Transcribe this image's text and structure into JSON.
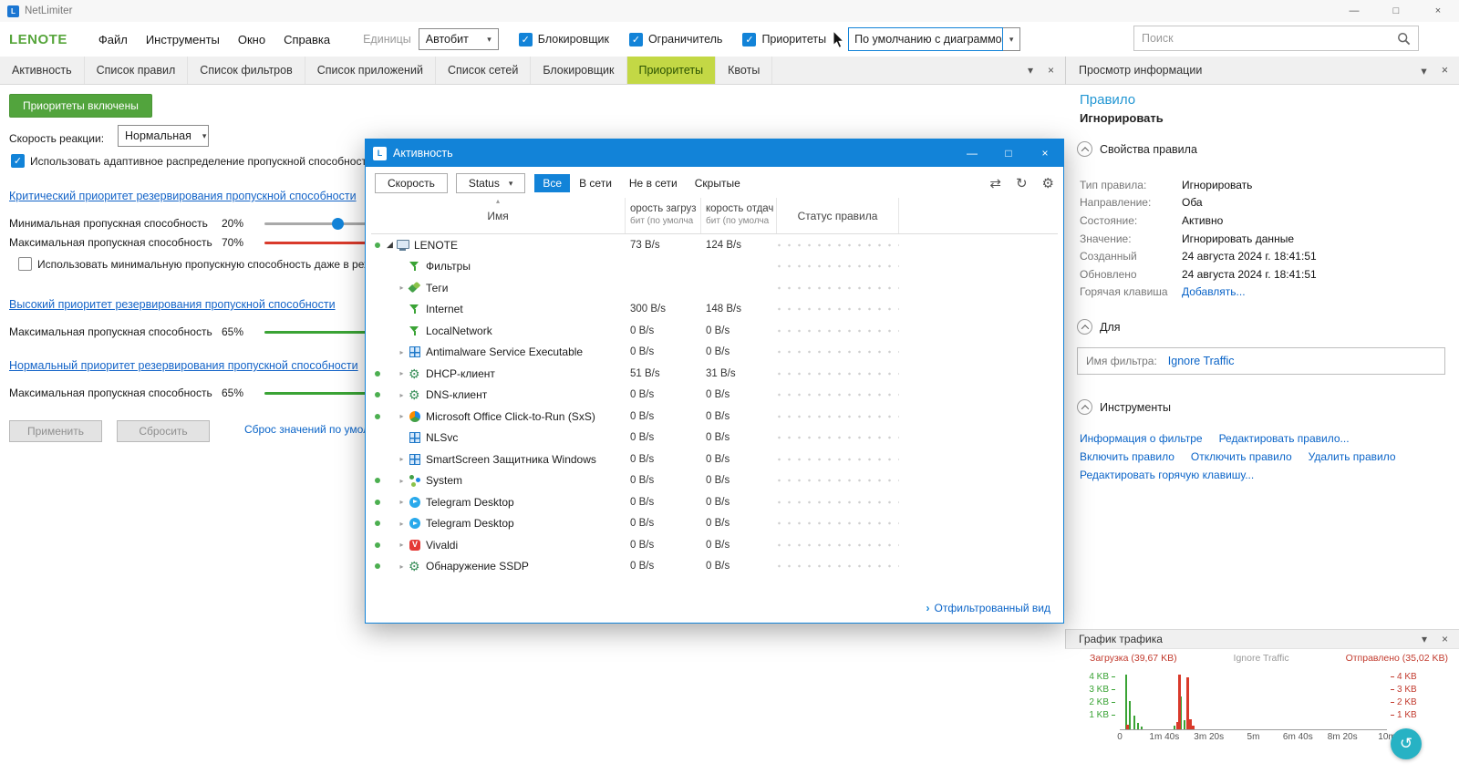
{
  "icons": {
    "check": "✓",
    "dropdown": "▾",
    "close": "×",
    "minimize": "—",
    "maximize": "□",
    "refresh": "↻",
    "gear": "⚙",
    "dock": "⇄",
    "collapsed": "▸",
    "expanded": "◢",
    "chevron_right": "›",
    "sort_asc": "▴",
    "undo": "↺"
  },
  "titlebar": {
    "app_title": "NetLimiter"
  },
  "menubar": {
    "logo": "LENOTE",
    "items": [
      "Файл",
      "Инструменты",
      "Окно",
      "Справка"
    ],
    "units_label": "Единицы",
    "units_value": "Автобит",
    "checkboxes": [
      "Блокировщик",
      "Ограничитель",
      "Приоритеты"
    ],
    "chart_mode_value": "По умолчанию с диаграммой",
    "search_placeholder": "Поиск"
  },
  "tabs": [
    {
      "label": "Активность"
    },
    {
      "label": "Список правил"
    },
    {
      "label": "Список фильтров"
    },
    {
      "label": "Список приложений"
    },
    {
      "label": "Список сетей"
    },
    {
      "label": "Блокировщик"
    },
    {
      "label": "Приоритеты",
      "active": true
    },
    {
      "label": "Квоты"
    }
  ],
  "priorities": {
    "enabled_button": "Приоритеты включены",
    "reaction_label": "Скорость реакции:",
    "reaction_value": "Нормальная",
    "adaptive_label": "Использовать адаптивное распределение пропускной способности",
    "critical_heading": "Критический приоритет резервирования пропускной способности",
    "min_label": "Минимальная пропускная способность",
    "min_value": "20%",
    "max_label": "Максимальная пропускная способность",
    "max_value": "70%",
    "idle_label": "Использовать минимальную пропускную способность даже в реж",
    "high_heading": "Высокий приоритет резервирования пропускной способности",
    "high_max_label": "Максимальная пропускная способность",
    "high_max_value": "65%",
    "normal_heading": "Нормальный приоритет резервирования пропускной способности",
    "normal_max_label": "Максимальная пропускная способность",
    "normal_max_value": "65%",
    "apply_button": "Применить",
    "reset_button": "Сбросить",
    "defaults_link": "Сброс значений по умолч"
  },
  "activity": {
    "title": "Активность",
    "toolbar": {
      "speed_button": "Скорость",
      "status_dropdown": "Status",
      "filters": [
        {
          "label": "Все",
          "active": true
        },
        {
          "label": "В сети"
        },
        {
          "label": "Не в сети"
        },
        {
          "label": "Скрытые"
        }
      ]
    },
    "columns": {
      "name": "Имя",
      "download_line1": "орость загруз",
      "download_line2": "бит (по умолча",
      "upload_line1": "корость отдач",
      "upload_line2": "бит (по умолча",
      "status": "Статус правила"
    },
    "rows": [
      {
        "name": "LENOTE",
        "icon": "monitor",
        "indent": 0,
        "tri": "exp",
        "online": true,
        "down": "73 B/s",
        "up": "124 B/s"
      },
      {
        "name": "Фильтры",
        "icon": "funnel",
        "indent": 1,
        "tri": "",
        "online": false,
        "down": "",
        "up": ""
      },
      {
        "name": "Теги",
        "icon": "tags",
        "indent": 1,
        "tri": "col",
        "online": false,
        "down": "",
        "up": ""
      },
      {
        "name": "Internet",
        "icon": "funnel",
        "indent": 1,
        "tri": "",
        "online": false,
        "down": "300 B/s",
        "up": "148 B/s"
      },
      {
        "name": "LocalNetwork",
        "icon": "funnel",
        "indent": 1,
        "tri": "",
        "online": false,
        "down": "0 B/s",
        "up": "0 B/s"
      },
      {
        "name": "Antimalware Service Executable",
        "icon": "window",
        "indent": 1,
        "tri": "col",
        "online": false,
        "down": "0 B/s",
        "up": "0 B/s"
      },
      {
        "name": "DHCP-клиент",
        "icon": "gear",
        "indent": 1,
        "tri": "col",
        "online": true,
        "down": "51 B/s",
        "up": "31 B/s"
      },
      {
        "name": "DNS-клиент",
        "icon": "gear",
        "indent": 1,
        "tri": "col",
        "online": true,
        "down": "0 B/s",
        "up": "0 B/s"
      },
      {
        "name": "Microsoft Office Click-to-Run (SxS)",
        "icon": "office",
        "indent": 1,
        "tri": "col",
        "online": true,
        "down": "0 B/s",
        "up": "0 B/s"
      },
      {
        "name": "NLSvc",
        "icon": "window",
        "indent": 1,
        "tri": "",
        "online": false,
        "down": "0 B/s",
        "up": "0 B/s"
      },
      {
        "name": "SmartScreen Защитника Windows",
        "icon": "window",
        "indent": 1,
        "tri": "col",
        "online": false,
        "down": "0 B/s",
        "up": "0 B/s"
      },
      {
        "name": "System",
        "icon": "system",
        "indent": 1,
        "tri": "col",
        "online": true,
        "down": "0 B/s",
        "up": "0 B/s"
      },
      {
        "name": "Telegram Desktop",
        "icon": "telegram",
        "indent": 1,
        "tri": "col",
        "online": true,
        "down": "0 B/s",
        "up": "0 B/s"
      },
      {
        "name": "Telegram Desktop",
        "icon": "telegram",
        "indent": 1,
        "tri": "col",
        "online": true,
        "down": "0 B/s",
        "up": "0 B/s"
      },
      {
        "name": "Vivaldi",
        "icon": "vivaldi",
        "indent": 1,
        "tri": "col",
        "online": true,
        "down": "0 B/s",
        "up": "0 B/s"
      },
      {
        "name": "Обнаружение SSDP",
        "icon": "gear",
        "indent": 1,
        "tri": "col",
        "online": true,
        "down": "0 B/s",
        "up": "0 B/s"
      }
    ],
    "footer_link": "Отфильтрованный вид"
  },
  "info": {
    "header": "Просмотр информации",
    "object_type": "Правило",
    "object_name": "Игнорировать",
    "properties_title": "Свойства правила",
    "properties": [
      {
        "label": "Тип правила:",
        "value": "Игнорировать"
      },
      {
        "label": "Направление:",
        "value": "Оба"
      },
      {
        "label": "Состояние:",
        "value": "Активно"
      },
      {
        "label": "Значение:",
        "value": "Игнорировать данные"
      },
      {
        "label": "Созданный",
        "value": "24 августа 2024 г. 18:41:51"
      },
      {
        "label": "Обновлено",
        "value": "24 августа 2024 г. 18:41:51"
      },
      {
        "label": "Горячая клавиша",
        "value": "Добавлять...",
        "link": true
      }
    ],
    "for_title": "Для",
    "filter_label": "Имя фильтра:",
    "filter_value": "Ignore Traffic",
    "tools_title": "Инструменты",
    "tools": {
      "lines": [
        [
          "Информация о фильтре",
          "Редактировать правило..."
        ],
        [
          "Включить правило",
          "Отключить правило",
          "Удалить правило"
        ],
        [
          "Редактировать горячую клавишу..."
        ]
      ]
    }
  },
  "traffic": {
    "header": "График трафика"
  },
  "chart_data": {
    "type": "area",
    "title": "График трафика",
    "legend": [
      "Загрузка (39,67 KB)",
      "Ignore Traffic",
      "Отправлено (35,02 KB)"
    ],
    "legend_position": "top",
    "x_tick_labels": [
      "0",
      "1m 40s",
      "3m 20s",
      "5m",
      "6m 40s",
      "8m 20s",
      "10m"
    ],
    "x_range_seconds": [
      0,
      600
    ],
    "y_tick_labels_left": [
      "4 KB",
      "3 KB",
      "2 KB",
      "1 KB"
    ],
    "y_tick_labels_right": [
      "4 KB",
      "3 KB",
      "2 KB",
      "1 KB"
    ],
    "ylim_kb": [
      0,
      5
    ],
    "grid": false,
    "series": [
      {
        "name": "Загрузка",
        "color": "#3aa335",
        "total": "39,67 KB",
        "spikes": [
          [
            0.02,
            4.3
          ],
          [
            0.035,
            2.2
          ],
          [
            0.05,
            1.1
          ],
          [
            0.065,
            0.5
          ],
          [
            0.08,
            0.25
          ],
          [
            0.2,
            0.3
          ],
          [
            0.225,
            2.6
          ],
          [
            0.24,
            0.7
          ],
          [
            0.26,
            0.3
          ]
        ]
      },
      {
        "name": "Отправлено",
        "color": "#d93a2b",
        "total": "35,02 KB",
        "spikes": [
          [
            0.025,
            0.35
          ],
          [
            0.21,
            0.6
          ],
          [
            0.218,
            4.3
          ],
          [
            0.248,
            4.1
          ],
          [
            0.258,
            0.8
          ],
          [
            0.27,
            0.3
          ]
        ]
      }
    ]
  }
}
